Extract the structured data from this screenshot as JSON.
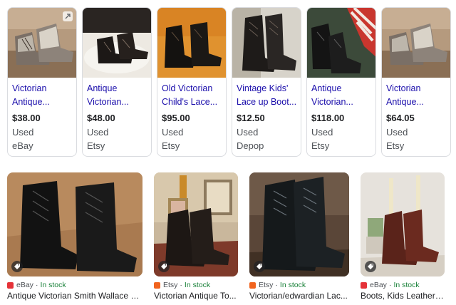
{
  "products": [
    {
      "title_line1": "Victorian",
      "title_line2": "Antique...",
      "price": "$38.00",
      "condition": "Used",
      "seller": "eBay",
      "has_expand_icon": true
    },
    {
      "title_line1": "Antique",
      "title_line2": "Victorian...",
      "price": "$48.00",
      "condition": "Used",
      "seller": "Etsy",
      "has_expand_icon": false
    },
    {
      "title_line1": "Old Victorian",
      "title_line2": "Child's Lace...",
      "price": "$95.00",
      "condition": "Used",
      "seller": "Etsy",
      "has_expand_icon": false
    },
    {
      "title_line1": "Vintage Kids'",
      "title_line2": "Lace up Boot...",
      "price": "$12.50",
      "condition": "Used",
      "seller": "Depop",
      "has_expand_icon": false
    },
    {
      "title_line1": "Antique",
      "title_line2": "Victorian...",
      "price": "$118.00",
      "condition": "Used",
      "seller": "Etsy",
      "has_expand_icon": false
    },
    {
      "title_line1": "Victorian",
      "title_line2": "Antique...",
      "price": "$64.05",
      "condition": "Used",
      "seller": "Etsy",
      "has_expand_icon": false
    }
  ],
  "image_results": [
    {
      "source": "eBay",
      "separator": "·",
      "stock": "In stock",
      "title": "Antique Victorian Smith Wallace S...",
      "favicon_color": "#e53238"
    },
    {
      "source": "Etsy",
      "separator": "·",
      "stock": "In stock",
      "title": "Victorian Antique To...",
      "favicon_color": "#f1641e"
    },
    {
      "source": "Etsy",
      "separator": "·",
      "stock": "In stock",
      "title": "Victorian/edwardian Lac...",
      "favicon_color": "#f1641e"
    },
    {
      "source": "eBay",
      "separator": "·",
      "stock": "In stock",
      "title": "Boots, Kids Leather ...",
      "favicon_color": "#e53238"
    }
  ],
  "icons": {
    "expand": "expand-icon",
    "tag": "price-tag-icon"
  },
  "colors": {
    "link": "#1a0dab",
    "in_stock": "#188038",
    "secondary_text": "#4d5156",
    "border": "#dadce0"
  }
}
